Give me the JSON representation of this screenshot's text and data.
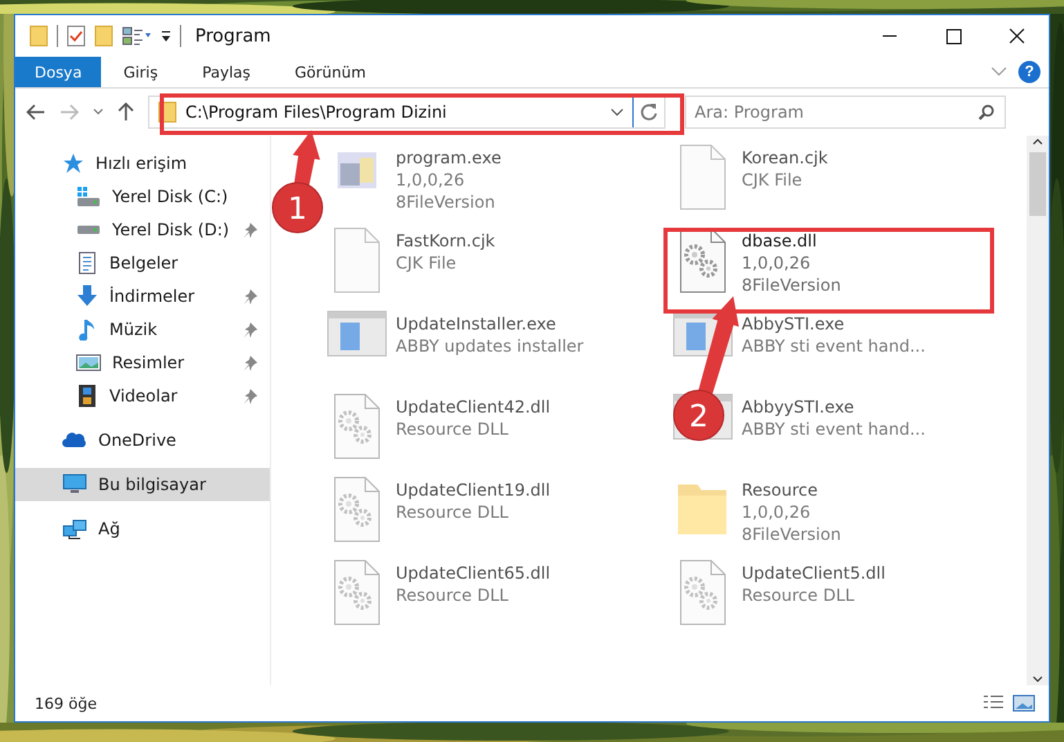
{
  "window": {
    "title": "Program"
  },
  "ribbon_tabs": [
    {
      "label": "Dosya",
      "selected": true
    },
    {
      "label": "Giriş",
      "selected": false
    },
    {
      "label": "Paylaş",
      "selected": false
    },
    {
      "label": "Görünüm",
      "selected": false
    }
  ],
  "help_glyph": "?",
  "address": {
    "value": "C:\\Program Files\\Program Dizini"
  },
  "search": {
    "placeholder": "Ara: Program"
  },
  "nav_items": [
    {
      "label": "Hızlı erişim",
      "kind": "star",
      "pinned": false,
      "selected": false,
      "group": true
    },
    {
      "label": "Yerel Disk (C:)",
      "kind": "drive-win",
      "pinned": false,
      "selected": false,
      "group": false
    },
    {
      "label": "Yerel Disk (D:)",
      "kind": "drive",
      "pinned": true,
      "selected": false,
      "group": false
    },
    {
      "label": "Belgeler",
      "kind": "doc",
      "pinned": false,
      "selected": false,
      "group": false
    },
    {
      "label": "İndirmeler",
      "kind": "down",
      "pinned": true,
      "selected": false,
      "group": false
    },
    {
      "label": "Müzik",
      "kind": "music",
      "pinned": true,
      "selected": false,
      "group": false
    },
    {
      "label": "Resimler",
      "pinned": true,
      "selected": false,
      "group": false
    },
    {
      "label": "Videolar",
      "kind": "film",
      "pinned": true,
      "selected": false,
      "group": false
    },
    {
      "label": "OneDrive",
      "kind": "cloud",
      "pinned": false,
      "selected": false,
      "group": true
    },
    {
      "label": "Bu bilgisayar",
      "kind": "pc",
      "pinned": false,
      "selected": true,
      "group": true
    },
    {
      "label": "Ağ",
      "kind": "network",
      "pinned": false,
      "selected": false,
      "group": true
    }
  ],
  "files": [
    {
      "name": "program.exe",
      "details": [
        "1,0,0,26",
        "8FileVersion"
      ],
      "kind": "exe",
      "focused": false
    },
    {
      "name": "Korean.cjk",
      "details": [
        "CJK File"
      ],
      "kind": "blank",
      "focused": false
    },
    {
      "name": "FastKorn.cjk",
      "details": [
        "CJK File"
      ],
      "kind": "blank",
      "focused": false
    },
    {
      "name": "dbase.dll",
      "details": [
        "1,0,0,26",
        "8FileVersion"
      ],
      "kind": "dll",
      "focused": true
    },
    {
      "name": "UpdateInstaller.exe",
      "details": [
        "ABBY updates installer"
      ],
      "kind": "app",
      "focused": false
    },
    {
      "name": "AbbySTI.exe",
      "details": [
        "ABBY sti event hand..."
      ],
      "kind": "app",
      "focused": false
    },
    {
      "name": "UpdateClient42.dll",
      "details": [
        "Resource DLL"
      ],
      "kind": "dll",
      "focused": false
    },
    {
      "name": "AbbyySTI.exe",
      "details": [
        "ABBY sti event hand..."
      ],
      "kind": "app",
      "focused": false
    },
    {
      "name": "UpdateClient19.dll",
      "details": [
        "Resource DLL"
      ],
      "kind": "dll",
      "focused": false
    },
    {
      "name": "Resource",
      "details": [
        "1,0,0,26",
        "8FileVersion"
      ],
      "kind": "folder",
      "focused": false
    },
    {
      "name": "UpdateClient65.dll",
      "details": [
        "Resource DLL"
      ],
      "kind": "dll",
      "focused": false
    },
    {
      "name": "UpdateClient5.dll",
      "details": [
        "Resource DLL"
      ],
      "kind": "dll",
      "focused": false
    }
  ],
  "status_bar": {
    "count": "169 öğe"
  },
  "annotations": [
    {
      "number": "1"
    },
    {
      "number": "2"
    }
  ]
}
